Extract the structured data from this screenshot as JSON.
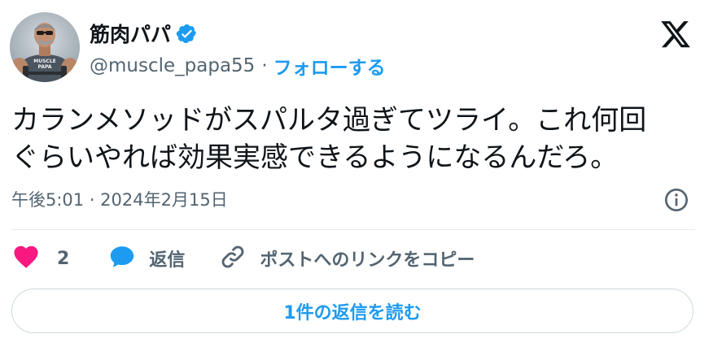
{
  "author": {
    "display_name": "筋肉パパ",
    "handle": "@muscle_papa55",
    "separator": "·",
    "follow_label": "フォローする",
    "avatar_shirt_text_line1": "MUSCLE",
    "avatar_shirt_text_line2": "PAPA"
  },
  "tweet": {
    "text": "カランメソッドがスパルタ過ぎてツライ。これ何回\nぐらいやれば効果実感できるようになるんだろ。",
    "timestamp": "午後5:01 · 2024年2月15日"
  },
  "actions": {
    "like_count": "2",
    "reply_label": "返信",
    "copy_link_label": "ポストへのリンクをコピー"
  },
  "footer": {
    "read_replies_label": "1件の返信を読む"
  },
  "icons": {
    "verified": "verified-badge-icon",
    "brand": "x-logo-icon",
    "info": "info-icon",
    "like": "heart-icon",
    "reply": "speech-bubble-icon",
    "copy": "link-icon"
  },
  "colors": {
    "accent": "#1d9bf0",
    "like": "#f91880",
    "text_primary": "#0f1419",
    "text_secondary": "#536471",
    "border": "#cfd9de"
  }
}
